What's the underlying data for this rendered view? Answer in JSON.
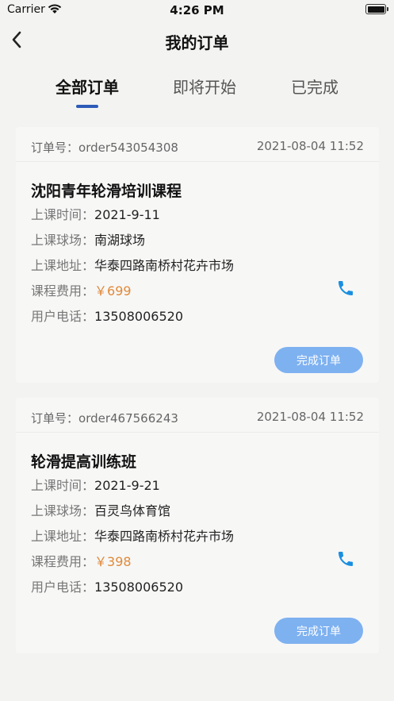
{
  "status_bar": {
    "carrier": "Carrier",
    "time": "4:26 PM"
  },
  "nav": {
    "title": "我的订单"
  },
  "tabs": [
    {
      "label": "全部订单",
      "active": true
    },
    {
      "label": "即将开始",
      "active": false
    },
    {
      "label": "已完成",
      "active": false
    }
  ],
  "labels": {
    "order_no": "订单号：",
    "class_time": "上课时间：",
    "venue": "上课球场：",
    "address": "上课地址：",
    "fee": "课程费用：",
    "phone": "用户电话："
  },
  "orders": [
    {
      "order_no": "order543054308",
      "created": "2021-08-04 11:52",
      "title": "沈阳青年轮滑培训课程",
      "class_time": "2021-9-11",
      "venue": "南湖球场",
      "address": "华泰四路南桥村花卉市场",
      "fee": "￥699",
      "phone": "13508006520",
      "action": "完成订单"
    },
    {
      "order_no": "order467566243",
      "created": "2021-08-04 11:52",
      "title": "轮滑提高训练班",
      "class_time": "2021-9-21",
      "venue": "百灵鸟体育馆",
      "address": "华泰四路南桥村花卉市场",
      "fee": "￥398",
      "phone": "13508006520",
      "action": "完成订单"
    }
  ],
  "colors": {
    "accent": "#2d5bb8",
    "button": "#7eb1f0",
    "price": "#e08a3a",
    "phone_icon": "#1a8fe0"
  }
}
